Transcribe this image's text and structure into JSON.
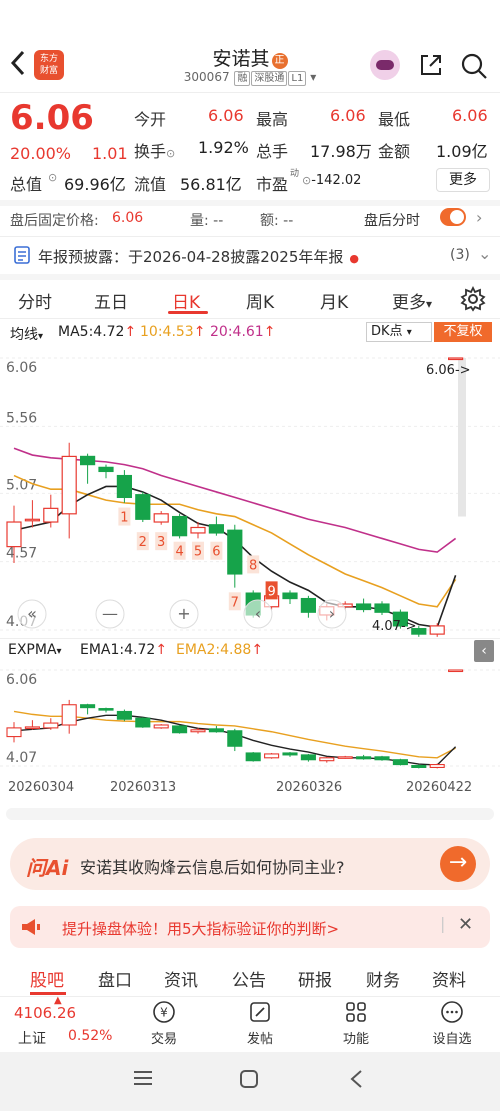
{
  "header": {
    "logo_text_1": "东方",
    "logo_text_2": "财富",
    "stock_name": "安诺其",
    "name_badge": "正",
    "code": "300067",
    "tag_rong": "融",
    "tag_sgt": "深股通",
    "tag_l1": "L1"
  },
  "quote": {
    "price": "6.06",
    "pct": "20.00%",
    "chg": "1.01",
    "rows": [
      {
        "l1": "今开",
        "v1": "6.06",
        "l2": "最高",
        "v2": "6.06",
        "l3": "最低",
        "v3": "6.06"
      },
      {
        "l1": "换手",
        "v1": "1.92%",
        "l2": "总手",
        "v2": "17.98万",
        "l3": "金额",
        "v3": "1.09亿"
      },
      {
        "l1": "总值",
        "v1": "69.96亿",
        "l2": "流值",
        "v2": "56.81亿",
        "l3": "市盈",
        "v3": "-142.02"
      }
    ],
    "pe_sup": "动",
    "more": "更多"
  },
  "after_hours": {
    "label": "盘后固定价格:",
    "price": "6.06",
    "vol_label": "量:",
    "vol": "--",
    "amt_label": "额:",
    "amt": "--",
    "toggle_label": "盘后分时"
  },
  "notice": {
    "label": "年报预披露：",
    "text": "于2026-04-28披露2025年年报",
    "count": "(3)"
  },
  "tabs": [
    "分时",
    "五日",
    "日K",
    "周K",
    "月K",
    "更多"
  ],
  "indicator": {
    "ma_label": "均线",
    "ma5": "MA5:4.72",
    "ma10": "10:4.53",
    "ma20": "20:4.61",
    "dk": "DK点",
    "fq": "不复权",
    "ema_label": "EXPMA",
    "ema1": "EMA1:4.72",
    "ema2": "EMA2:4.88"
  },
  "chart_data": {
    "type": "candlestick",
    "y_ticks_main": [
      "6.06",
      "5.56",
      "5.07",
      "4.57",
      "4.07"
    ],
    "y_ticks_sub": [
      "6.06",
      "4.07"
    ],
    "x_labels": [
      "20260304",
      "20260313",
      "20260326",
      "20260422"
    ],
    "ylim": [
      4.07,
      6.06
    ],
    "last_label": "6.06->",
    "low_label": "4.07->",
    "candles": [
      {
        "o": 4.68,
        "c": 4.86,
        "h": 4.98,
        "l": 4.56
      },
      {
        "o": 4.88,
        "c": 4.88,
        "h": 5.02,
        "l": 4.82
      },
      {
        "o": 4.86,
        "c": 4.96,
        "h": 5.06,
        "l": 4.82
      },
      {
        "o": 4.92,
        "c": 5.34,
        "h": 5.44,
        "l": 4.74
      },
      {
        "o": 5.34,
        "c": 5.28,
        "h": 5.36,
        "l": 5.14
      },
      {
        "o": 5.26,
        "c": 5.23,
        "h": 5.28,
        "l": 5.18
      },
      {
        "o": 5.2,
        "c": 5.04,
        "h": 5.24,
        "l": 5.0
      },
      {
        "o": 5.06,
        "c": 4.88,
        "h": 5.08,
        "l": 4.86
      },
      {
        "o": 4.86,
        "c": 4.92,
        "h": 4.94,
        "l": 4.84
      },
      {
        "o": 4.9,
        "c": 4.76,
        "h": 4.92,
        "l": 4.74
      },
      {
        "o": 4.78,
        "c": 4.82,
        "h": 4.86,
        "l": 4.74
      },
      {
        "o": 4.84,
        "c": 4.78,
        "h": 4.9,
        "l": 4.76
      },
      {
        "o": 4.8,
        "c": 4.48,
        "h": 4.84,
        "l": 4.38
      },
      {
        "o": 4.34,
        "c": 4.18,
        "h": 4.36,
        "l": 4.16
      },
      {
        "o": 4.24,
        "c": 4.32,
        "h": 4.34,
        "l": 4.22
      },
      {
        "o": 4.34,
        "c": 4.3,
        "h": 4.36,
        "l": 4.26
      },
      {
        "o": 4.3,
        "c": 4.2,
        "h": 4.32,
        "l": 4.16
      },
      {
        "o": 4.18,
        "c": 4.24,
        "h": 4.26,
        "l": 4.14
      },
      {
        "o": 4.24,
        "c": 4.26,
        "h": 4.28,
        "l": 4.22
      },
      {
        "o": 4.26,
        "c": 4.22,
        "h": 4.3,
        "l": 4.2
      },
      {
        "o": 4.26,
        "c": 4.2,
        "h": 4.28,
        "l": 4.18
      },
      {
        "o": 4.2,
        "c": 4.1,
        "h": 4.22,
        "l": 4.08
      },
      {
        "o": 4.08,
        "c": 4.04,
        "h": 4.1,
        "l": 4.02
      },
      {
        "o": 4.04,
        "c": 4.1,
        "h": 4.12,
        "l": 4.02
      },
      {
        "o": 6.06,
        "c": 6.06,
        "h": 6.06,
        "l": 6.06
      }
    ],
    "ma5": [
      4.8,
      4.83,
      4.86,
      4.98,
      5.06,
      5.12,
      5.12,
      5.08,
      5.02,
      4.93,
      4.85,
      4.82,
      4.73,
      4.6,
      4.5,
      4.42,
      4.36,
      4.27,
      4.24,
      4.24,
      4.22,
      4.17,
      4.11,
      4.09,
      4.47
    ],
    "ma10": [
      5.2,
      5.14,
      5.1,
      5.1,
      5.06,
      5.02,
      5.0,
      4.99,
      4.99,
      4.99,
      4.95,
      4.92,
      4.9,
      4.84,
      4.78,
      4.7,
      4.62,
      4.55,
      4.48,
      4.43,
      4.38,
      4.32,
      4.26,
      4.24,
      4.44
    ],
    "ma20": [
      5.4,
      5.35,
      5.33,
      5.32,
      5.31,
      5.3,
      5.28,
      5.25,
      5.2,
      5.16,
      5.12,
      5.08,
      5.04,
      5.0,
      4.96,
      4.92,
      4.88,
      4.85,
      4.82,
      4.78,
      4.74,
      4.7,
      4.66,
      4.64,
      4.74
    ],
    "nine_turn": [
      "1",
      "2",
      "3",
      "4",
      "5",
      "6",
      "7",
      "8",
      "9"
    ]
  },
  "ai": {
    "brand": "问Ai",
    "question": "安诺其收购烽云信息后如何协同主业?"
  },
  "promo": {
    "text": "提升操盘体验！用5大指标验证你的判断>"
  },
  "bottom_tabs": [
    "股吧",
    "盘口",
    "资讯",
    "公告",
    "研报",
    "财务",
    "资料"
  ],
  "index": {
    "value": "4106.26",
    "name": "上证",
    "pct": "0.52%"
  },
  "tools": [
    "交易",
    "发帖",
    "功能",
    "设自选"
  ],
  "colors": {
    "up": "#e8382f",
    "down": "#16a34a",
    "accent": "#f06a2c",
    "ma5": "#222222",
    "ma10": "#e8a020",
    "ma20": "#c0308a"
  }
}
